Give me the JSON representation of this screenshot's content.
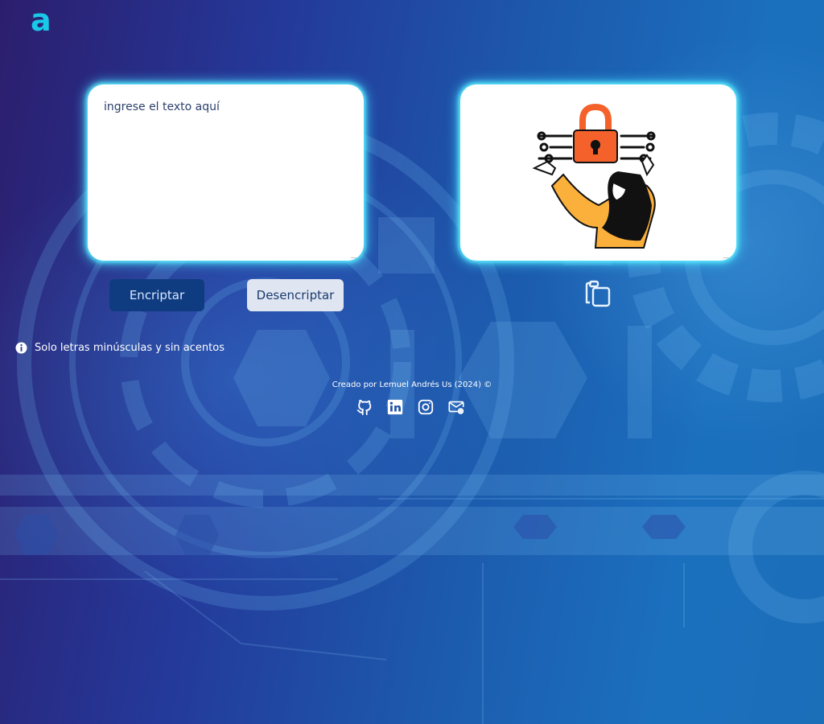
{
  "logo": {
    "text": "a"
  },
  "input": {
    "placeholder": "ingrese el texto aquí"
  },
  "buttons": {
    "encrypt": "Encriptar",
    "decrypt": "Desencriptar",
    "copy_icon": "copy-icon"
  },
  "info": {
    "icon": "info-icon",
    "text": "Solo letras minúsculas y sin acentos"
  },
  "footer": {
    "credit": "Creado por Lemuel Andrés Us (2024) ©",
    "social": [
      "github-icon",
      "linkedin-icon",
      "instagram-icon",
      "email-icon"
    ]
  },
  "colors": {
    "accent": "#19c9e8",
    "encrypt_button": "#0f3c80",
    "decrypt_button": "#dfe6f1",
    "lock": "#f4612b",
    "jacket": "#fbb03b"
  }
}
